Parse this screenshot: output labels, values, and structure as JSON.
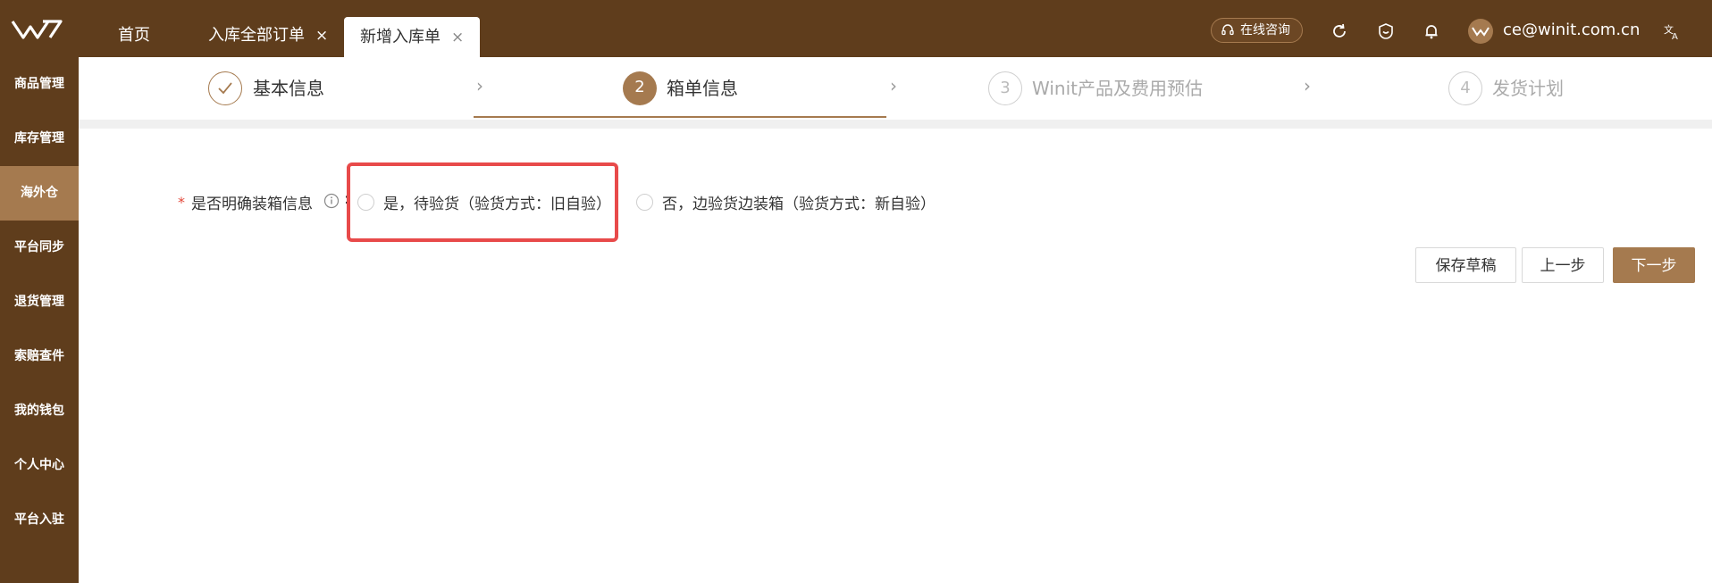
{
  "tabs": [
    {
      "label": "首页"
    },
    {
      "label": "入库全部订单",
      "close": "×"
    },
    {
      "label": "新增入库单",
      "close": "×"
    }
  ],
  "header": {
    "consult_label": "在线咨询",
    "user_email": "ce@winit.com.cn",
    "icons": [
      "refresh-icon",
      "smile-icon",
      "bell-icon",
      "translate-icon"
    ]
  },
  "sidebar": {
    "items": [
      {
        "label": "商品管理"
      },
      {
        "label": "库存管理"
      },
      {
        "label": "海外仓",
        "active": true
      },
      {
        "label": "平台同步"
      },
      {
        "label": "退货管理"
      },
      {
        "label": "索赔查件"
      },
      {
        "label": "我的钱包"
      },
      {
        "label": "个人中心"
      },
      {
        "label": "平台入驻"
      }
    ]
  },
  "steps": [
    {
      "num": "",
      "label": "基本信息",
      "state": "done"
    },
    {
      "num": "2",
      "label": "箱单信息",
      "state": "active"
    },
    {
      "num": "3",
      "label": "Winit产品及费用预估",
      "state": "pending"
    },
    {
      "num": "4",
      "label": "发货计划",
      "state": "pending"
    }
  ],
  "form": {
    "required_mark": "*",
    "field_label": "是否明确装箱信息",
    "colon": ":",
    "options": [
      {
        "label": "是，待验货（验货方式：旧自验）"
      },
      {
        "label": "否，边验货边装箱（验货方式：新自验）"
      }
    ]
  },
  "buttons": {
    "save_draft": "保存草稿",
    "prev": "上一步",
    "next": "下一步"
  },
  "colors": {
    "brand_dark": "#5f3d1c",
    "brand_accent": "#a57a4f",
    "highlight": "#e84a4a"
  }
}
